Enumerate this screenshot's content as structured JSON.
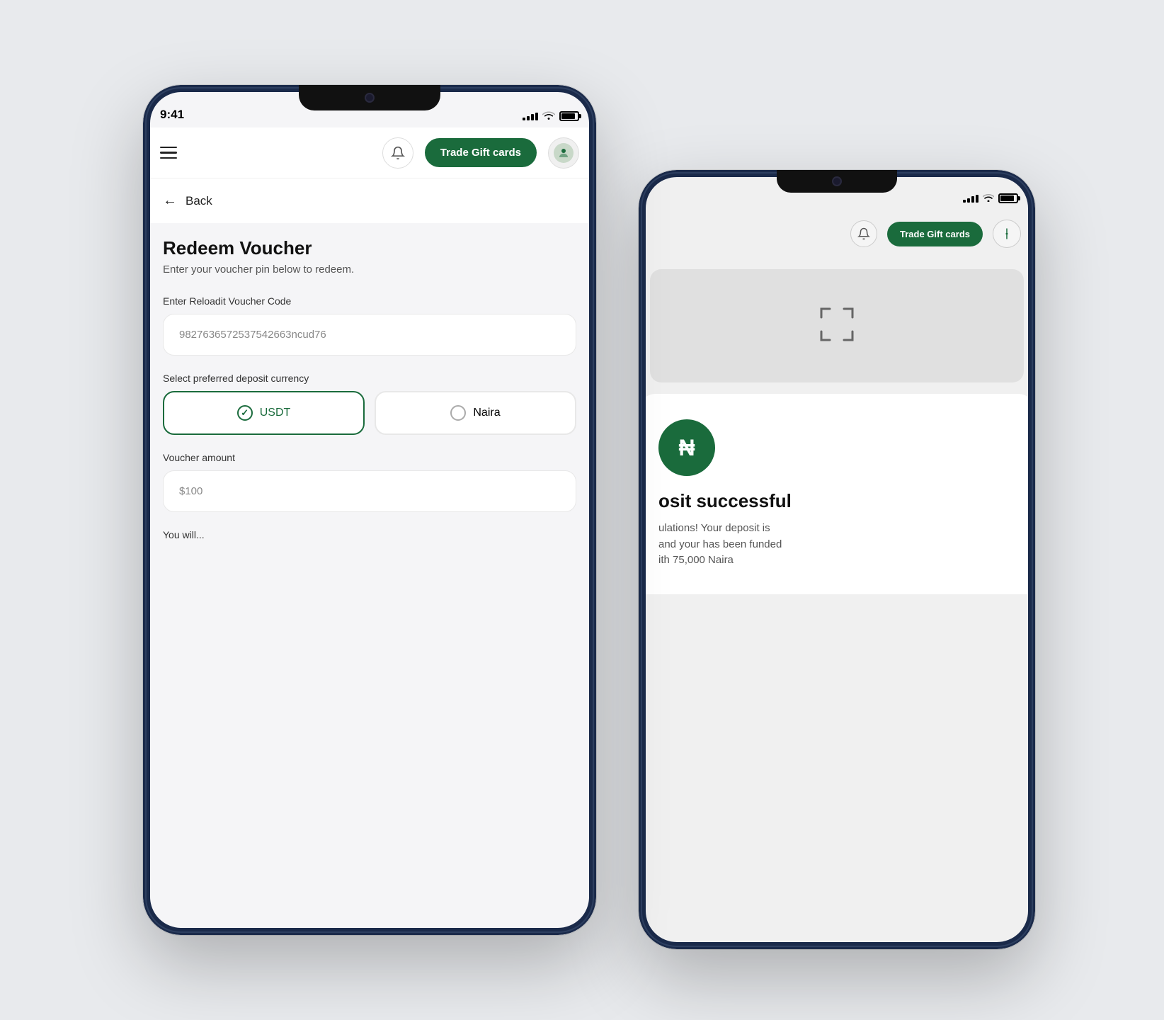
{
  "background": "#e8eaed",
  "phone1": {
    "status": {
      "time": "9:41",
      "signal_bars": [
        3,
        5,
        7,
        9,
        11
      ],
      "wifi": "wifi",
      "battery": 85
    },
    "header": {
      "menu_icon": "hamburger-menu",
      "bell_icon": "bell",
      "trade_button_label": "Trade Gift cards",
      "avatar_icon": "user-avatar"
    },
    "back_label": "Back",
    "page": {
      "title": "Redeem Voucher",
      "subtitle": "Enter your voucher pin below to redeem.",
      "voucher_code_label": "Enter Reloadit Voucher Code",
      "voucher_code_value": "9827636572537542663ncud76",
      "currency_label": "Select preferred deposit currency",
      "currencies": [
        {
          "id": "usdt",
          "label": "USDT",
          "selected": true
        },
        {
          "id": "naira",
          "label": "Naira",
          "selected": false
        }
      ],
      "voucher_amount_label": "Voucher amount",
      "voucher_amount_value": "$100",
      "you_will_label": "You will..."
    }
  },
  "phone2": {
    "status": {
      "signal_bars": [
        3,
        5,
        7,
        9,
        11
      ],
      "wifi": "wifi",
      "battery": 85
    },
    "header": {
      "bell_icon": "bell",
      "trade_button_label": "Trade Gift cards",
      "filter_icon": "filter"
    },
    "scan_icon": "scan-qr",
    "success": {
      "icon": "naira",
      "title": "osit successful",
      "text_line1": "ulations! Your deposit is",
      "text_line2": "and your has been funded",
      "text_line3": "ith 75,000 Naira"
    }
  }
}
